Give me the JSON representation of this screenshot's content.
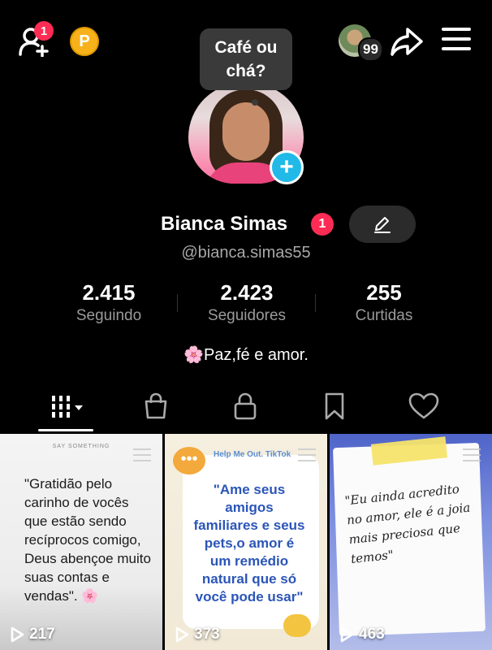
{
  "top_bar": {
    "add_user_badge": "1",
    "coin_label": "P",
    "visitors_count": "99"
  },
  "tooltip": {
    "text": "Café ou chá?"
  },
  "profile": {
    "name": "Bianca Simas",
    "name_badge": "1",
    "handle": "@bianca.simas55",
    "bio": "🌸Paz,fé e amor."
  },
  "stats": [
    {
      "value": "2.415",
      "label": "Seguindo"
    },
    {
      "value": "2.423",
      "label": "Seguidores"
    },
    {
      "value": "255",
      "label": "Curtidas"
    }
  ],
  "tabs": {
    "items": [
      "videos-grid-icon",
      "shop-bag-icon",
      "lock-icon",
      "bookmark-icon",
      "heart-icon"
    ],
    "active": 0
  },
  "videos": [
    {
      "header": "SAY SOMETHING",
      "text": "\"Gratidão pelo carinho de vocês que estão sendo recíprocos comigo, Deus abençoe muito suas contas e vendas\". 🌸",
      "views": "217"
    },
    {
      "header": "Help Me Out. TikTok",
      "text": "\"Ame seus amigos familiares e seus pets,o amor é um remédio natural que só você pode usar\"",
      "views": "373"
    },
    {
      "header": "",
      "text": "\"Eu ainda acredito no amor, ele é a joia mais preciosa que temos\"",
      "views": "463"
    }
  ],
  "colors": {
    "badge": "#fe2c55",
    "coin": "#f7b21b",
    "avatar_plus": "#20b9e8"
  }
}
